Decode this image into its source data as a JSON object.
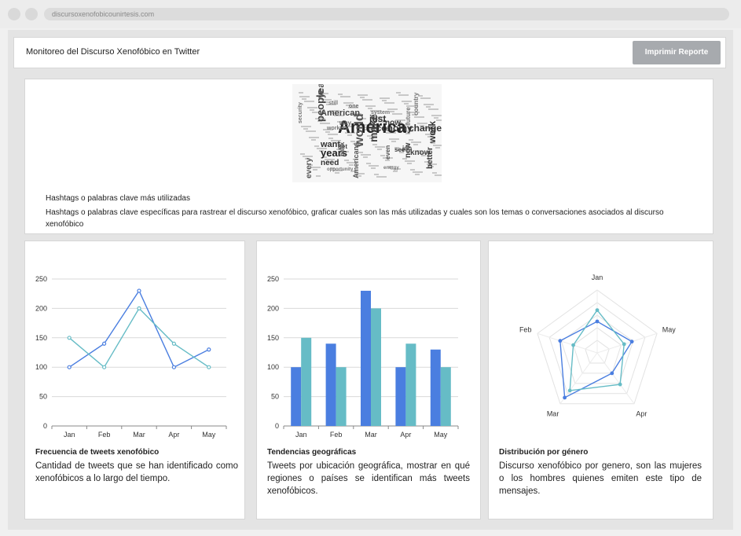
{
  "browser": {
    "url": "discursoxenofobicounirtesis.com"
  },
  "header": {
    "title": "Monitoreo del Discurso Xenofóbico en Twitter",
    "print_button": "Imprimir Reporte"
  },
  "hashtags": {
    "caption": "Hashtags o palabras clave más utilizadas",
    "description": "Hashtags o palabras clave específicas para rastrear el discurso xenofóbico, graficar cuales son las más utilizadas y cuales son los temas o conversaciones asociados al discurso xenofóbico",
    "words": [
      "America",
      "people",
      "year",
      "years",
      "economy",
      "work",
      "just",
      "now",
      "make",
      "world",
      "change",
      "want",
      "need",
      "American",
      "every",
      "better",
      "Americans",
      "new",
      "know",
      "even",
      "job",
      "future",
      "country",
      "way",
      "get",
      "back",
      "see",
      "one",
      "still",
      "security",
      "workers",
      "system",
      "energy",
      "opportunity"
    ]
  },
  "colors": {
    "blue": "#4a7ee0",
    "teal": "#66bcc6",
    "grid": "#d9d9d9"
  },
  "cards": [
    {
      "title": "Frecuencia de tweets xenofóbico",
      "description": "Cantidad de tweets que se han identificado como xenofóbicos a lo largo del tiempo."
    },
    {
      "title": "Tendencias geográficas",
      "description": "Tweets por ubicación geográfica, mostrar en qué regiones o países se identifican más tweets xenofóbicos."
    },
    {
      "title": "Distribución por género",
      "description": "Discurso xenofóbico por genero, son las mujeres o los hombres quienes emiten este tipo de mensajes."
    }
  ],
  "chart_data": [
    {
      "type": "line",
      "categories": [
        "Jan",
        "Feb",
        "Mar",
        "Apr",
        "May"
      ],
      "series": [
        {
          "values": [
            100,
            140,
            230,
            100,
            130
          ],
          "color": "#4a7ee0"
        },
        {
          "values": [
            150,
            100,
            200,
            140,
            100
          ],
          "color": "#66bcc6"
        }
      ],
      "ylim": [
        0,
        250
      ],
      "yticks": [
        0,
        50,
        100,
        150,
        200,
        250
      ],
      "grid": true
    },
    {
      "type": "bar",
      "categories": [
        "Jan",
        "Feb",
        "Mar",
        "Apr",
        "May"
      ],
      "series": [
        {
          "values": [
            100,
            140,
            230,
            100,
            130
          ],
          "color": "#4a7ee0"
        },
        {
          "values": [
            150,
            100,
            200,
            140,
            100
          ],
          "color": "#66bcc6"
        }
      ],
      "ylim": [
        0,
        250
      ],
      "yticks": [
        0,
        50,
        100,
        150,
        200,
        250
      ],
      "grid": true
    },
    {
      "type": "radar",
      "categories": [
        "Jan",
        "May",
        "Apr",
        "Mar",
        "Feb"
      ],
      "max": 100,
      "series": [
        {
          "values": [
            50,
            58,
            40,
            88,
            62
          ],
          "color": "#4a7ee0"
        },
        {
          "values": [
            68,
            45,
            62,
            74,
            40
          ],
          "color": "#66bcc6"
        }
      ]
    }
  ]
}
